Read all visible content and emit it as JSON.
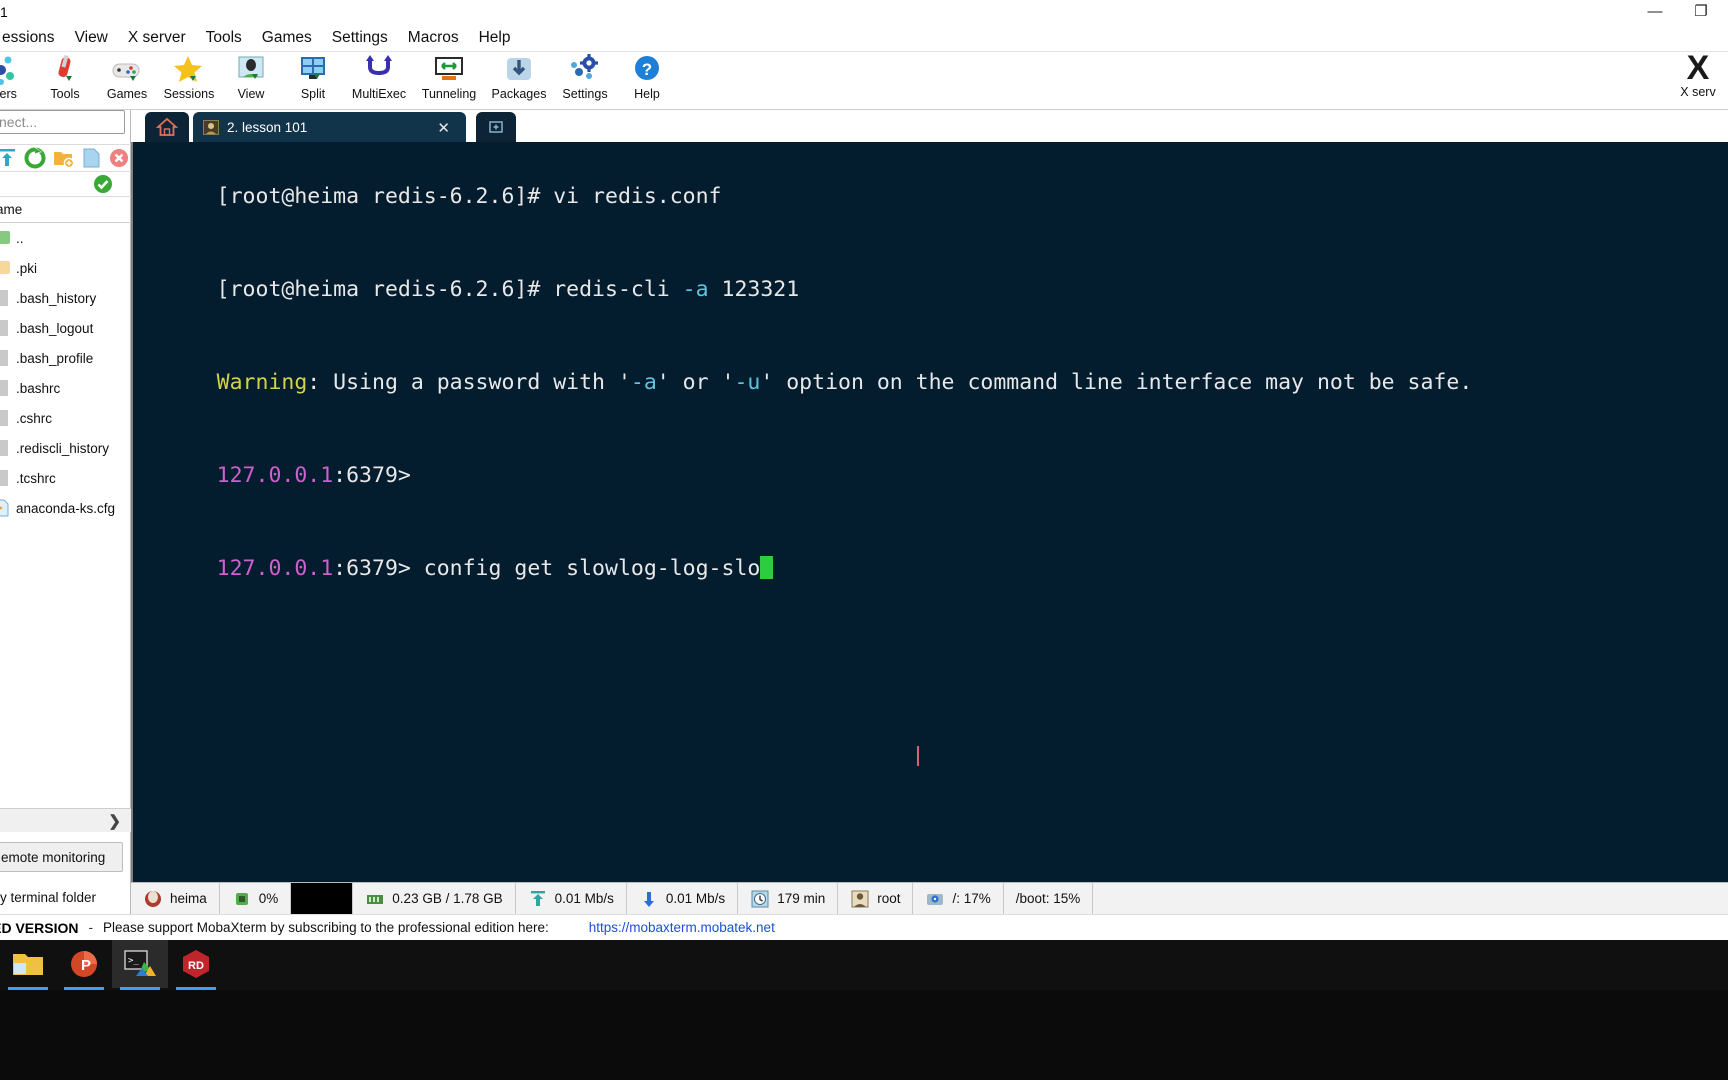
{
  "window": {
    "title": "1",
    "minimize_label": "—",
    "maximize_label": "❐",
    "close_label": "✕"
  },
  "menubar": {
    "items": [
      {
        "label": "essions",
        "name": "menu-sessions"
      },
      {
        "label": "View",
        "name": "menu-view"
      },
      {
        "label": "X server",
        "name": "menu-xserver"
      },
      {
        "label": "Tools",
        "name": "menu-tools"
      },
      {
        "label": "Games",
        "name": "menu-games"
      },
      {
        "label": "Settings",
        "name": "menu-settings"
      },
      {
        "label": "Macros",
        "name": "menu-macros"
      },
      {
        "label": "Help",
        "name": "menu-help"
      }
    ]
  },
  "toolbar": {
    "items": [
      {
        "label": "rvers",
        "icon": "servers-icon"
      },
      {
        "label": "Tools",
        "icon": "tools-icon"
      },
      {
        "label": "Games",
        "icon": "games-icon"
      },
      {
        "label": "Sessions",
        "icon": "sessions-star-icon"
      },
      {
        "label": "View",
        "icon": "view-icon"
      },
      {
        "label": "Split",
        "icon": "split-icon"
      },
      {
        "label": "MultiExec",
        "icon": "multiexec-icon"
      },
      {
        "label": "Tunneling",
        "icon": "tunneling-icon"
      },
      {
        "label": "Packages",
        "icon": "packages-icon"
      },
      {
        "label": "Settings",
        "icon": "settings-gear-icon"
      },
      {
        "label": "Help",
        "icon": "help-icon"
      }
    ],
    "right_label": "X serv",
    "right_icon": "x-server-icon"
  },
  "sidebar": {
    "search_placeholder": "nect...",
    "column_header": "ame",
    "toolbar_icons": [
      "upload-icon",
      "refresh-icon",
      "new-folder-icon",
      "new-file-icon",
      "delete-icon"
    ],
    "status_icon": "connected-check-icon",
    "files": [
      {
        "name": "..",
        "type": "parent-folder"
      },
      {
        "name": ".pki",
        "type": "folder"
      },
      {
        "name": ".bash_history",
        "type": "file"
      },
      {
        "name": ".bash_logout",
        "type": "file"
      },
      {
        "name": ".bash_profile",
        "type": "file"
      },
      {
        "name": ".bashrc",
        "type": "file"
      },
      {
        "name": ".cshrc",
        "type": "file"
      },
      {
        "name": ".rediscli_history",
        "type": "file"
      },
      {
        "name": ".tcshrc",
        "type": "file"
      },
      {
        "name": "anaconda-ks.cfg",
        "type": "config"
      }
    ],
    "expander_icon": "chevron-right-icon",
    "buttons": [
      {
        "label": "emote monitoring",
        "name": "remote-monitoring-button"
      },
      {
        "label": "y terminal folder",
        "name": "terminal-folder-button"
      }
    ]
  },
  "tabs": {
    "home_icon": "home-icon",
    "active": {
      "label": "2. lesson 101",
      "icon": "ssh-session-icon",
      "close_label": "✕"
    },
    "new_tab_icon": "new-tab-icon"
  },
  "terminal": {
    "lines": [
      {
        "segments": [
          {
            "text": "[root@heima redis-6.2.6]# vi redis.conf",
            "color": "prompt"
          }
        ]
      },
      {
        "segments": [
          {
            "text": "[root@heima redis-6.2.6]# redis-cli ",
            "color": "prompt"
          },
          {
            "text": "-a",
            "color": "flag"
          },
          {
            "text": " 123321",
            "color": "prompt"
          }
        ]
      },
      {
        "segments": [
          {
            "text": "Warning",
            "color": "warn"
          },
          {
            "text": ": Using a password with '",
            "color": "prompt"
          },
          {
            "text": "-a",
            "color": "flag"
          },
          {
            "text": "' or '",
            "color": "prompt"
          },
          {
            "text": "-u",
            "color": "flag"
          },
          {
            "text": "' option on the command line interface may not be safe.",
            "color": "prompt"
          }
        ]
      },
      {
        "segments": [
          {
            "text": "127.0.0.1",
            "color": "host"
          },
          {
            "text": ":6379> ",
            "color": "prompt"
          }
        ]
      },
      {
        "segments": [
          {
            "text": "127.0.0.1",
            "color": "host"
          },
          {
            "text": ":6379> config get slowlog-log-slo",
            "color": "prompt"
          }
        ],
        "cursor": true
      }
    ]
  },
  "statusbar": {
    "cells": [
      {
        "icon": "host-icon",
        "label": "heima",
        "name": "status-host"
      },
      {
        "icon": "cpu-icon",
        "label": "0%",
        "name": "status-cpu"
      },
      {
        "icon": "",
        "label": "",
        "name": "status-graph"
      },
      {
        "icon": "memory-icon",
        "label": "0.23 GB / 1.78 GB",
        "name": "status-memory"
      },
      {
        "icon": "upload-arrow-icon",
        "label": "0.01 Mb/s",
        "name": "status-upload"
      },
      {
        "icon": "download-arrow-icon",
        "label": "0.01 Mb/s",
        "name": "status-download"
      },
      {
        "icon": "clock-icon",
        "label": "179 min",
        "name": "status-uptime"
      },
      {
        "icon": "user-icon",
        "label": "root",
        "name": "status-user"
      },
      {
        "icon": "disk-icon",
        "label": "/: 17%",
        "name": "status-disk-root"
      },
      {
        "icon": "",
        "label": "/boot: 15%",
        "name": "status-disk-boot"
      }
    ]
  },
  "footer": {
    "version": "RED VERSION",
    "dash": "-",
    "message": "Please support MobaXterm by subscribing to the professional edition here:",
    "link": "https://mobaxterm.mobatek.net"
  },
  "taskbar": {
    "items": [
      {
        "name": "taskbar-explorer",
        "icon": "folder-icon",
        "active": false
      },
      {
        "name": "taskbar-powerpoint",
        "icon": "powerpoint-icon",
        "active": false
      },
      {
        "name": "taskbar-mobaxterm",
        "icon": "mobaxterm-icon",
        "active": true
      },
      {
        "name": "taskbar-redis-desktop",
        "icon": "redis-desktop-icon",
        "active": false
      }
    ]
  },
  "colors": {
    "terminal_bg": "#031c2e",
    "tab_active": "#12344b",
    "accent_green": "#2ecc40",
    "warn_yellow": "#d3d34a",
    "host_magenta": "#d05fd0",
    "flag_cyan": "#5fc4e0",
    "link_blue": "#1a4fd6"
  }
}
